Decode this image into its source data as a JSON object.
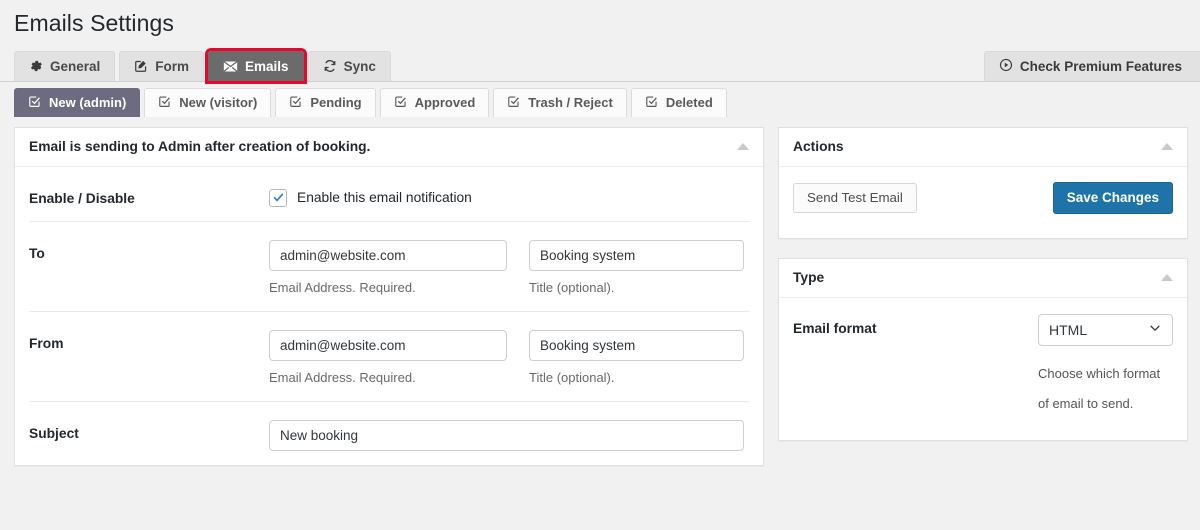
{
  "page": {
    "title": "Emails Settings"
  },
  "top_tabs": [
    {
      "label": "General",
      "icon": "gear-icon",
      "active": false
    },
    {
      "label": "Form",
      "icon": "edit-square-icon",
      "active": false
    },
    {
      "label": "Emails",
      "icon": "envelope-icon",
      "active": true
    },
    {
      "label": "Sync",
      "icon": "refresh-icon",
      "active": false
    }
  ],
  "premium": {
    "label": "Check Premium Features",
    "icon": "play-circle-icon"
  },
  "sub_tabs": [
    {
      "label": "New (admin)",
      "icon": "check-square-icon",
      "active": true
    },
    {
      "label": "New (visitor)",
      "icon": "check-square-icon",
      "active": false
    },
    {
      "label": "Pending",
      "icon": "check-square-icon",
      "active": false
    },
    {
      "label": "Approved",
      "icon": "check-square-icon",
      "active": false
    },
    {
      "label": "Trash / Reject",
      "icon": "check-square-icon",
      "active": false
    },
    {
      "label": "Deleted",
      "icon": "check-square-icon",
      "active": false
    }
  ],
  "main_panel": {
    "title": "Email is sending to Admin after creation of booking.",
    "collapse_icon": "triangle-up-icon",
    "rows": {
      "enable": {
        "label": "Enable / Disable",
        "checkbox_label": "Enable this email notification",
        "checked": true
      },
      "to": {
        "label": "To",
        "email_value": "admin@website.com",
        "email_hint": "Email Address. Required.",
        "title_value": "Booking system",
        "title_hint": "Title (optional)."
      },
      "from": {
        "label": "From",
        "email_value": "admin@website.com",
        "email_hint": "Email Address. Required.",
        "title_value": "Booking system",
        "title_hint": "Title (optional)."
      },
      "subject": {
        "label": "Subject",
        "value": "New booking"
      }
    }
  },
  "actions_panel": {
    "title": "Actions",
    "collapse_icon": "triangle-up-icon",
    "test_label": "Send Test Email",
    "save_label": "Save Changes",
    "save_color": "#1e73a8"
  },
  "type_panel": {
    "title": "Type",
    "collapse_icon": "triangle-up-icon",
    "format_label": "Email format",
    "format_value": "HTML",
    "format_hint": "Choose which format of email to send.",
    "dropdown_icon": "chevron-down-icon"
  }
}
